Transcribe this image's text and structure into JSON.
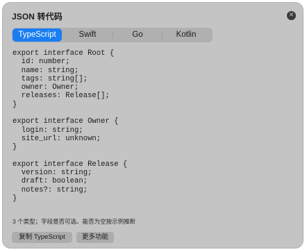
{
  "window": {
    "title": "JSON 转代码",
    "close_icon": "close-icon"
  },
  "tabs": [
    {
      "label": "TypeScript",
      "active": true
    },
    {
      "label": "Swift",
      "active": false
    },
    {
      "label": "Go",
      "active": false
    },
    {
      "label": "Kotlin",
      "active": false
    }
  ],
  "code": {
    "language": "TypeScript",
    "lines": [
      "export interface Root {",
      "  id: number;",
      "  name: string;",
      "  tags: string[];",
      "  owner: Owner;",
      "  releases: Release[];",
      "}",
      "",
      "export interface Owner {",
      "  login: string;",
      "  site_url: unknown;",
      "}",
      "",
      "export interface Release {",
      "  version: string;",
      "  draft: boolean;",
      "  notes?: string;",
      "}"
    ]
  },
  "footer": {
    "status": "3 个类型；字段是否可选、能否为空按示例推断",
    "copy_button": "复制 TypeScript",
    "more_button": "更多功能"
  },
  "colors": {
    "panel_bg": "#c4c4c4",
    "accent": "#1a7df2"
  }
}
